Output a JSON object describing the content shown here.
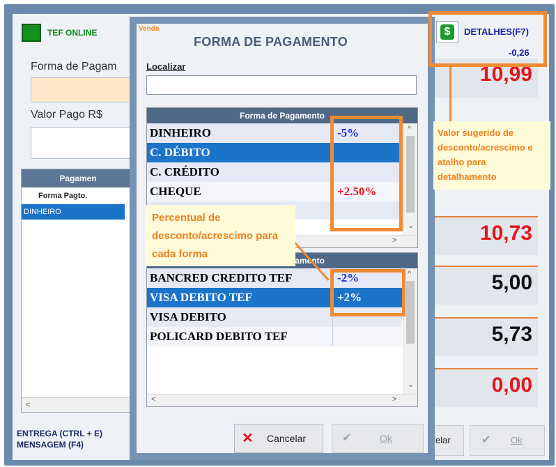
{
  "background": {
    "tef_status": "TEF ONLINE",
    "forma_label": "Forma de Pagam",
    "valor_label": "Valor Pago R$",
    "pagamentos_header": "Pagamen",
    "pagamentos_column": "Forma Pagto.",
    "pagamentos_row": "DINHEIRO",
    "shortcuts": [
      "ENTREGA (CTRL + E)",
      "MENSAGEM (F4)"
    ],
    "cancel_partial": "elar",
    "ok_label": "Ok",
    "details_button": "DETALHES(F7)",
    "details_value": "-0,26",
    "dollar_icon": "$",
    "values": [
      {
        "text": "10,99",
        "color": "#e8141c"
      },
      {
        "text": "10,73",
        "color": "#e8141c"
      },
      {
        "text": "5,00",
        "color": "#111111"
      },
      {
        "text": "5,73",
        "color": "#111111"
      },
      {
        "text": "0,00",
        "color": "#e8141c"
      }
    ]
  },
  "modal": {
    "venda_tag": "Venda",
    "title": "FORMA DE PAGAMENTO",
    "localizar_label": "Localizar",
    "localizar_value": "",
    "grid1": {
      "header": "Forma de Pagamento",
      "rows": [
        {
          "name": "DINHEIRO",
          "pct": "-5%",
          "pct_color": "#1b2bd8"
        },
        {
          "name": "C. DÉBITO",
          "pct": "",
          "pct_color": "#ffffff"
        },
        {
          "name": "C. CRÉDITO",
          "pct": "",
          "pct_color": "#111111"
        },
        {
          "name": "CHEQUE",
          "pct": "+2.50%",
          "pct_color": "#e8141c"
        }
      ]
    },
    "grid2": {
      "header": "Forma de Pagamento",
      "rows": [
        {
          "name": "BANCRED CREDITO TEF",
          "pct": "-2%",
          "pct_color": "#1b2bd8"
        },
        {
          "name": "VISA DEBITO TEF",
          "pct": "+2%",
          "pct_color": "#ffffff"
        },
        {
          "name": "VISA DEBITO",
          "pct": "",
          "pct_color": "#111111"
        },
        {
          "name": "POLICARD DEBITO TEF",
          "pct": "",
          "pct_color": "#111111"
        }
      ]
    },
    "cancel_button": "Cancelar",
    "ok_button": "Ok"
  },
  "annotations": {
    "right_callout": "Valor sugerido de desconto/acrescimo e atalho para detalhamento",
    "left_callout": "Percentual de desconto/acrescimo para cada forma",
    "accent_color": "#f08a33"
  },
  "icons": [
    "dollar-icon",
    "cancel-x-icon",
    "check-icon",
    "chevron-up-icon",
    "chevron-down-icon",
    "chevron-left-icon",
    "chevron-right-icon"
  ]
}
